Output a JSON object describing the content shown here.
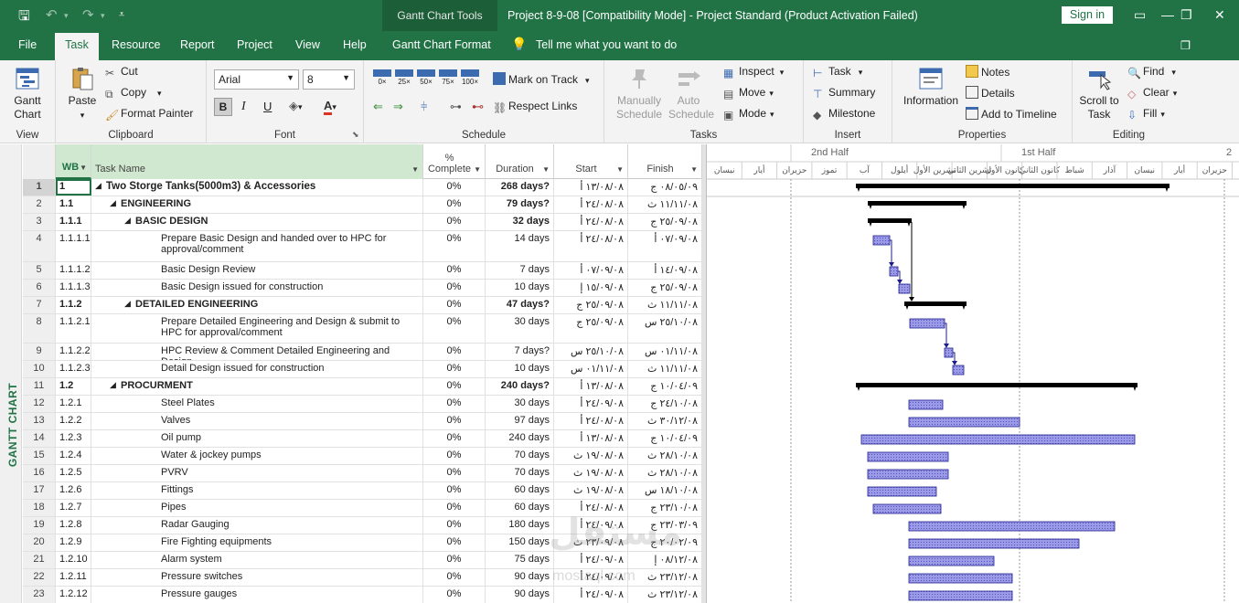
{
  "window": {
    "title": "Project 8-9-08 [Compatibility Mode]  -  Project Standard (Product Activation Failed)",
    "context_tools": "Gantt Chart Tools",
    "sign_in": "Sign in"
  },
  "tabs": [
    "File",
    "Task",
    "Resource",
    "Report",
    "Project",
    "View",
    "Help",
    "Gantt Chart Format"
  ],
  "tell_me": "Tell me what you want to do",
  "ribbon": {
    "view": {
      "gantt_chart": "Gantt Chart",
      "label": "View"
    },
    "clipboard": {
      "paste": "Paste",
      "cut": "Cut",
      "copy": "Copy",
      "format_painter": "Format Painter",
      "label": "Clipboard"
    },
    "font": {
      "family": "Arial",
      "size": "8",
      "bold": "B",
      "italic": "I",
      "underline": "U",
      "label": "Font"
    },
    "schedule": {
      "pct": [
        "0×",
        "25×",
        "50×",
        "75×",
        "100×"
      ],
      "mark_on_track": "Mark on Track",
      "respect_links": "Respect Links",
      "label": "Schedule"
    },
    "tasks": {
      "manually_schedule": "Manually Schedule",
      "auto_schedule": "Auto Schedule",
      "inspect": "Inspect",
      "move": "Move",
      "mode": "Mode",
      "label": "Tasks"
    },
    "insert": {
      "task": "Task",
      "summary": "Summary",
      "milestone": "Milestone",
      "label": "Insert"
    },
    "properties": {
      "information": "Information",
      "notes": "Notes",
      "details": "Details",
      "add_to_timeline": "Add to Timeline",
      "label": "Properties"
    },
    "editing": {
      "scroll_to_task": "Scroll to Task",
      "find": "Find",
      "clear": "Clear",
      "fill": "Fill",
      "label": "Editing"
    }
  },
  "sidebar_label": "GANTT CHART",
  "columns": {
    "wbs": "WB",
    "name": "Task Name",
    "pct": "% Complete",
    "duration": "Duration",
    "start": "Start",
    "finish": "Finish"
  },
  "rows": [
    {
      "id": "1",
      "wbs": "1",
      "name": "Two Storge Tanks(5000m3) & Accessories",
      "pct": "0%",
      "dur": "268 days?",
      "start": "١٣/٠٨/٠٨ أ",
      "finish": "٠٨/٠٥/٠٩ ج"
    },
    {
      "id": "2",
      "wbs": "1.1",
      "name": "ENGINEERING",
      "pct": "0%",
      "dur": "79 days?",
      "start": "٢٤/٠٨/٠٨ أ",
      "finish": "١١/١١/٠٨ ث"
    },
    {
      "id": "3",
      "wbs": "1.1.1",
      "name": "BASIC DESIGN",
      "pct": "0%",
      "dur": "32 days",
      "start": "٢٤/٠٨/٠٨ أ",
      "finish": "٢٥/٠٩/٠٨ ج"
    },
    {
      "id": "4",
      "wbs": "1.1.1.1",
      "name": "Prepare  Basic Design and handed over to HPC for approval/comment",
      "pct": "0%",
      "dur": "14 days",
      "start": "٢٤/٠٨/٠٨ أ",
      "finish": "٠٧/٠٩/٠٨ أ"
    },
    {
      "id": "5",
      "wbs": "1.1.1.2",
      "name": "Basic Design  Review",
      "pct": "0%",
      "dur": "7 days",
      "start": "٠٧/٠٩/٠٨ أ",
      "finish": "١٤/٠٩/٠٨ أ"
    },
    {
      "id": "6",
      "wbs": "1.1.1.3",
      "name": "Basic Design  issued for construction",
      "pct": "0%",
      "dur": "10 days",
      "start": "١٥/٠٩/٠٨ إ",
      "finish": "٢٥/٠٩/٠٨ ج"
    },
    {
      "id": "7",
      "wbs": "1.1.2",
      "name": "DETAILED ENGINEERING",
      "pct": "0%",
      "dur": "47 days?",
      "start": "٢٥/٠٩/٠٨ ج",
      "finish": "١١/١١/٠٨ ث"
    },
    {
      "id": "8",
      "wbs": "1.1.2.1",
      "name": "Prepare Detailed Engineering and Design & submit to HPC for approval/comment",
      "pct": "0%",
      "dur": "30 days",
      "start": "٢٥/٠٩/٠٨ ج",
      "finish": "٢٥/١٠/٠٨ س"
    },
    {
      "id": "9",
      "wbs": "1.1.2.2",
      "name": "HPC Review & Comment Detailed Engineering and Design",
      "pct": "0%",
      "dur": "7 days?",
      "start": "٢٥/١٠/٠٨ س",
      "finish": "٠١/١١/٠٨ س"
    },
    {
      "id": "10",
      "wbs": "1.1.2.3",
      "name": "Detail Design  issued for construction",
      "pct": "0%",
      "dur": "10 days",
      "start": "٠١/١١/٠٨ س",
      "finish": "١١/١١/٠٨ ث"
    },
    {
      "id": "11",
      "wbs": "1.2",
      "name": "PROCURMENT",
      "pct": "0%",
      "dur": "240 days?",
      "start": "١٣/٠٨/٠٨ أ",
      "finish": "١٠/٠٤/٠٩ ج"
    },
    {
      "id": "12",
      "wbs": "1.2.1",
      "name": "Steel Plates",
      "pct": "0%",
      "dur": "30 days",
      "start": "٢٤/٠٩/٠٨ أ",
      "finish": "٢٤/١٠/٠٨ ج"
    },
    {
      "id": "13",
      "wbs": "1.2.2",
      "name": "Valves",
      "pct": "0%",
      "dur": "97 days",
      "start": "٢٤/٠٨/٠٨ أ",
      "finish": "٣٠/١٢/٠٨ ث"
    },
    {
      "id": "14",
      "wbs": "1.2.3",
      "name": "Oil pump",
      "pct": "0%",
      "dur": "240 days",
      "start": "١٣/٠٨/٠٨ أ",
      "finish": "١٠/٠٤/٠٩ ج"
    },
    {
      "id": "15",
      "wbs": "1.2.4",
      "name": "Water & jockey pumps",
      "pct": "0%",
      "dur": "70 days",
      "start": "١٩/٠٨/٠٨ ث",
      "finish": "٢٨/١٠/٠٨ ث"
    },
    {
      "id": "16",
      "wbs": "1.2.5",
      "name": "PVRV",
      "pct": "0%",
      "dur": "70 days",
      "start": "١٩/٠٨/٠٨ ث",
      "finish": "٢٨/١٠/٠٨ ث"
    },
    {
      "id": "17",
      "wbs": "1.2.6",
      "name": "Fittings",
      "pct": "0%",
      "dur": "60 days",
      "start": "١٩/٠٨/٠٨ ث",
      "finish": "١٨/١٠/٠٨ س"
    },
    {
      "id": "18",
      "wbs": "1.2.7",
      "name": "Pipes",
      "pct": "0%",
      "dur": "60 days",
      "start": "٢٤/٠٨/٠٨ أ",
      "finish": "٢٣/١٠/٠٨ ج"
    },
    {
      "id": "19",
      "wbs": "1.2.8",
      "name": "Radar Gauging",
      "pct": "0%",
      "dur": "180 days",
      "start": "٢٤/٠٩/٠٨ أ",
      "finish": "٢٣/٠٣/٠٩ ج"
    },
    {
      "id": "20",
      "wbs": "1.2.9",
      "name": "Fire Fighting equipments",
      "pct": "0%",
      "dur": "150 days",
      "start": "٢٣/٠٩/٠٨ ث",
      "finish": "٢٠/٠٢/٠٩ ج"
    },
    {
      "id": "21",
      "wbs": "1.2.10",
      "name": "Alarm system",
      "pct": "0%",
      "dur": "75 days",
      "start": "٢٤/٠٩/٠٨ أ",
      "finish": "٠٨/١٢/٠٨ إ"
    },
    {
      "id": "22",
      "wbs": "1.2.11",
      "name": "Pressure switches",
      "pct": "0%",
      "dur": "90 days",
      "start": "٢٤/٠٩/٠٨ أ",
      "finish": "٢٣/١٢/٠٨ ث"
    },
    {
      "id": "23",
      "wbs": "1.2.12",
      "name": "Pressure gauges",
      "pct": "0%",
      "dur": "90 days",
      "start": "٢٤/٠٩/٠٨ أ",
      "finish": "٢٣/١٢/٠٨ ث"
    }
  ],
  "timescale": {
    "top": [
      "2nd Half",
      "1st Half",
      "2"
    ],
    "bottom": [
      "نيسان",
      "أيار",
      "حزيران",
      "تموز",
      "آب",
      "أيلول",
      "تشرين الأول",
      "تشرين الثاني",
      "كانون الأول",
      "كانون الثاني",
      "شباط",
      "آذار",
      "نيسان",
      "أيار",
      "حزيران"
    ]
  },
  "watermark": {
    "logo": "مستقل",
    "domain": "mostaql.com"
  },
  "colors": {
    "accent": "#217346",
    "bar_fill": "#9a9ae8",
    "bar_border": "#1c1c8c",
    "summary": "#000000"
  }
}
